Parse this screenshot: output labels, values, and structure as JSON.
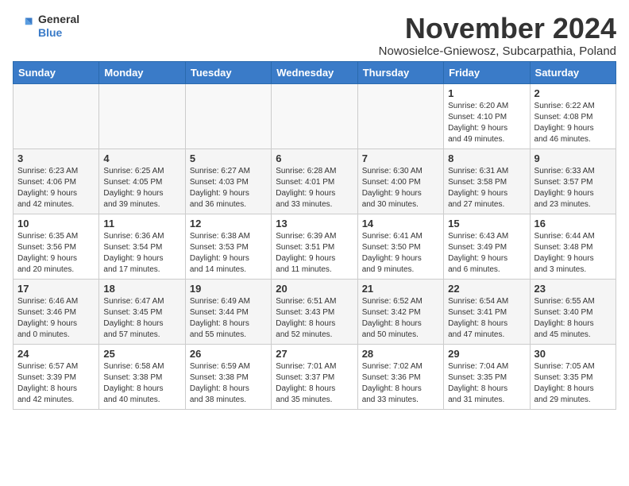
{
  "header": {
    "logo_line1": "General",
    "logo_line2": "Blue",
    "month_title": "November 2024",
    "subtitle": "Nowosielce-Gniewosz, Subcarpathia, Poland"
  },
  "weekdays": [
    "Sunday",
    "Monday",
    "Tuesday",
    "Wednesday",
    "Thursday",
    "Friday",
    "Saturday"
  ],
  "weeks": [
    [
      {
        "day": "",
        "info": ""
      },
      {
        "day": "",
        "info": ""
      },
      {
        "day": "",
        "info": ""
      },
      {
        "day": "",
        "info": ""
      },
      {
        "day": "",
        "info": ""
      },
      {
        "day": "1",
        "info": "Sunrise: 6:20 AM\nSunset: 4:10 PM\nDaylight: 9 hours\nand 49 minutes."
      },
      {
        "day": "2",
        "info": "Sunrise: 6:22 AM\nSunset: 4:08 PM\nDaylight: 9 hours\nand 46 minutes."
      }
    ],
    [
      {
        "day": "3",
        "info": "Sunrise: 6:23 AM\nSunset: 4:06 PM\nDaylight: 9 hours\nand 42 minutes."
      },
      {
        "day": "4",
        "info": "Sunrise: 6:25 AM\nSunset: 4:05 PM\nDaylight: 9 hours\nand 39 minutes."
      },
      {
        "day": "5",
        "info": "Sunrise: 6:27 AM\nSunset: 4:03 PM\nDaylight: 9 hours\nand 36 minutes."
      },
      {
        "day": "6",
        "info": "Sunrise: 6:28 AM\nSunset: 4:01 PM\nDaylight: 9 hours\nand 33 minutes."
      },
      {
        "day": "7",
        "info": "Sunrise: 6:30 AM\nSunset: 4:00 PM\nDaylight: 9 hours\nand 30 minutes."
      },
      {
        "day": "8",
        "info": "Sunrise: 6:31 AM\nSunset: 3:58 PM\nDaylight: 9 hours\nand 27 minutes."
      },
      {
        "day": "9",
        "info": "Sunrise: 6:33 AM\nSunset: 3:57 PM\nDaylight: 9 hours\nand 23 minutes."
      }
    ],
    [
      {
        "day": "10",
        "info": "Sunrise: 6:35 AM\nSunset: 3:56 PM\nDaylight: 9 hours\nand 20 minutes."
      },
      {
        "day": "11",
        "info": "Sunrise: 6:36 AM\nSunset: 3:54 PM\nDaylight: 9 hours\nand 17 minutes."
      },
      {
        "day": "12",
        "info": "Sunrise: 6:38 AM\nSunset: 3:53 PM\nDaylight: 9 hours\nand 14 minutes."
      },
      {
        "day": "13",
        "info": "Sunrise: 6:39 AM\nSunset: 3:51 PM\nDaylight: 9 hours\nand 11 minutes."
      },
      {
        "day": "14",
        "info": "Sunrise: 6:41 AM\nSunset: 3:50 PM\nDaylight: 9 hours\nand 9 minutes."
      },
      {
        "day": "15",
        "info": "Sunrise: 6:43 AM\nSunset: 3:49 PM\nDaylight: 9 hours\nand 6 minutes."
      },
      {
        "day": "16",
        "info": "Sunrise: 6:44 AM\nSunset: 3:48 PM\nDaylight: 9 hours\nand 3 minutes."
      }
    ],
    [
      {
        "day": "17",
        "info": "Sunrise: 6:46 AM\nSunset: 3:46 PM\nDaylight: 9 hours\nand 0 minutes."
      },
      {
        "day": "18",
        "info": "Sunrise: 6:47 AM\nSunset: 3:45 PM\nDaylight: 8 hours\nand 57 minutes."
      },
      {
        "day": "19",
        "info": "Sunrise: 6:49 AM\nSunset: 3:44 PM\nDaylight: 8 hours\nand 55 minutes."
      },
      {
        "day": "20",
        "info": "Sunrise: 6:51 AM\nSunset: 3:43 PM\nDaylight: 8 hours\nand 52 minutes."
      },
      {
        "day": "21",
        "info": "Sunrise: 6:52 AM\nSunset: 3:42 PM\nDaylight: 8 hours\nand 50 minutes."
      },
      {
        "day": "22",
        "info": "Sunrise: 6:54 AM\nSunset: 3:41 PM\nDaylight: 8 hours\nand 47 minutes."
      },
      {
        "day": "23",
        "info": "Sunrise: 6:55 AM\nSunset: 3:40 PM\nDaylight: 8 hours\nand 45 minutes."
      }
    ],
    [
      {
        "day": "24",
        "info": "Sunrise: 6:57 AM\nSunset: 3:39 PM\nDaylight: 8 hours\nand 42 minutes."
      },
      {
        "day": "25",
        "info": "Sunrise: 6:58 AM\nSunset: 3:38 PM\nDaylight: 8 hours\nand 40 minutes."
      },
      {
        "day": "26",
        "info": "Sunrise: 6:59 AM\nSunset: 3:38 PM\nDaylight: 8 hours\nand 38 minutes."
      },
      {
        "day": "27",
        "info": "Sunrise: 7:01 AM\nSunset: 3:37 PM\nDaylight: 8 hours\nand 35 minutes."
      },
      {
        "day": "28",
        "info": "Sunrise: 7:02 AM\nSunset: 3:36 PM\nDaylight: 8 hours\nand 33 minutes."
      },
      {
        "day": "29",
        "info": "Sunrise: 7:04 AM\nSunset: 3:35 PM\nDaylight: 8 hours\nand 31 minutes."
      },
      {
        "day": "30",
        "info": "Sunrise: 7:05 AM\nSunset: 3:35 PM\nDaylight: 8 hours\nand 29 minutes."
      }
    ]
  ]
}
